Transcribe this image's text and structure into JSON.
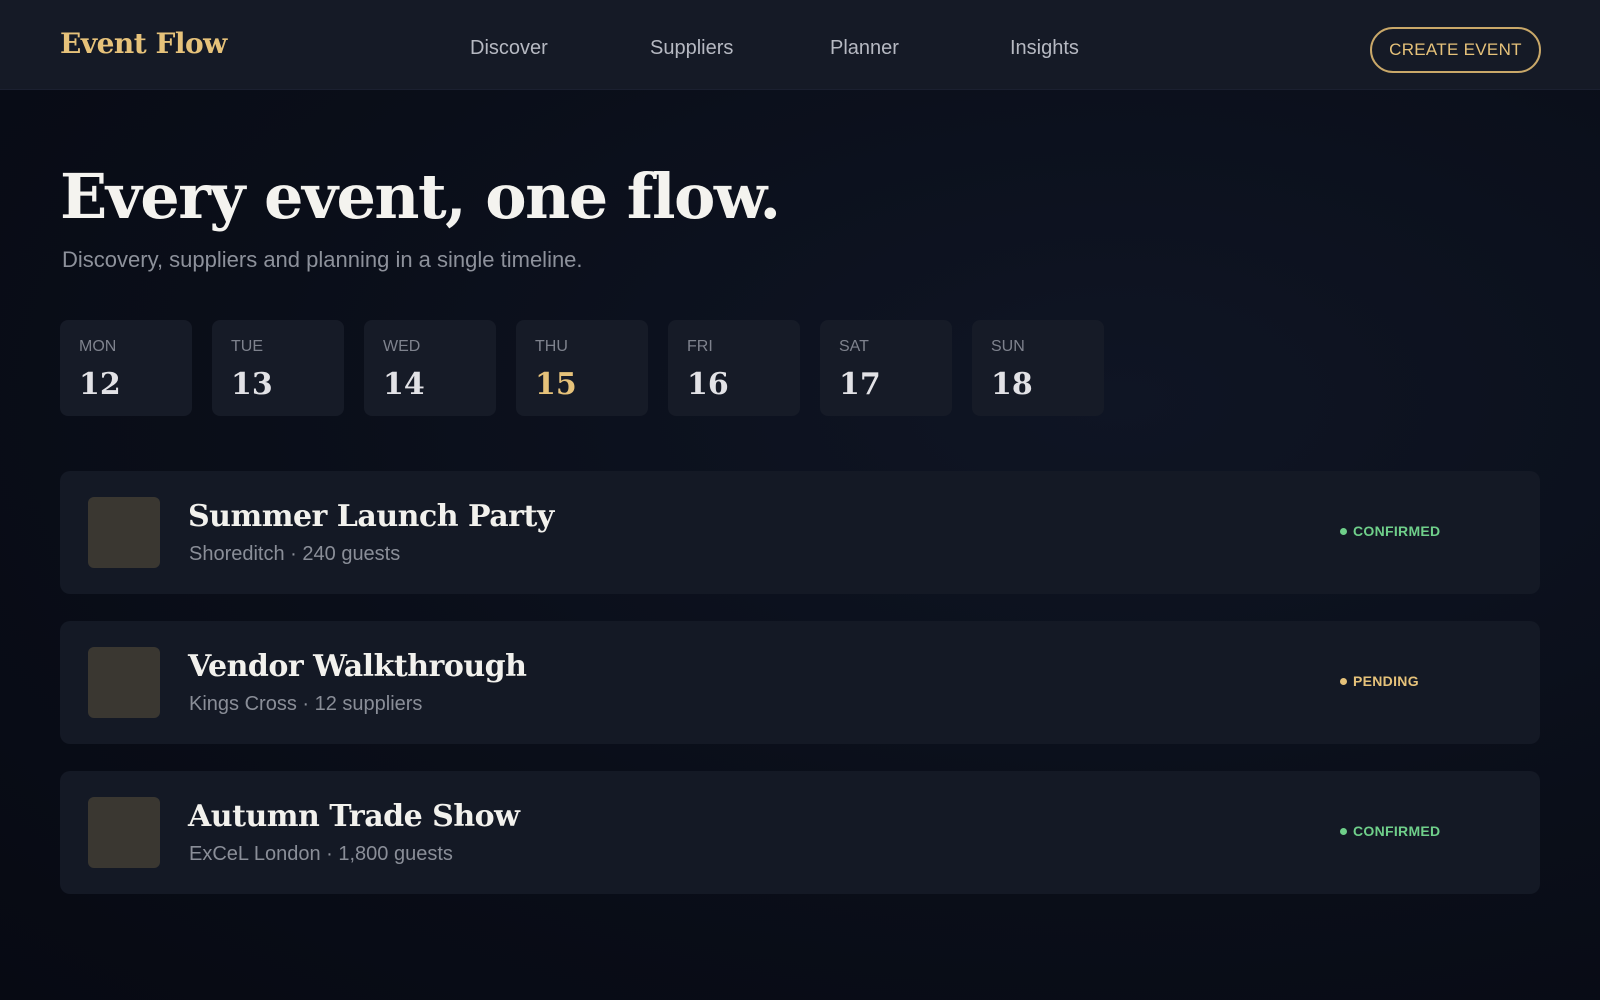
{
  "header": {
    "logo": "Event Flow",
    "nav": [
      "Discover",
      "Suppliers",
      "Planner",
      "Insights"
    ],
    "cta": "CREATE EVENT"
  },
  "hero": {
    "title": "Every event, one flow.",
    "subtitle": "Discovery, suppliers and planning in a single timeline."
  },
  "week": [
    {
      "day": "MON",
      "date": "12"
    },
    {
      "day": "TUE",
      "date": "13"
    },
    {
      "day": "WED",
      "date": "14"
    },
    {
      "day": "THU",
      "date": "15",
      "selected": true
    },
    {
      "day": "FRI",
      "date": "16"
    },
    {
      "day": "SAT",
      "date": "17"
    },
    {
      "day": "SUN",
      "date": "18"
    }
  ],
  "events": [
    {
      "title": "Summer Launch Party",
      "meta": "Shoreditch · 240 guests",
      "status": "CONFIRMED",
      "status_color": "#6fcf8a"
    },
    {
      "title": "Vendor Walkthrough",
      "meta": "Kings Cross · 12 suppliers",
      "status": "PENDING",
      "status_color": "#e6c27a"
    },
    {
      "title": "Autumn Trade Show",
      "meta": "ExCeL London · 1,800 guests",
      "status": "CONFIRMED",
      "status_color": "#6fcf8a"
    }
  ],
  "colors": {
    "accent": "#e6c27a",
    "background": "#0b0f1a",
    "card": "#141925"
  }
}
